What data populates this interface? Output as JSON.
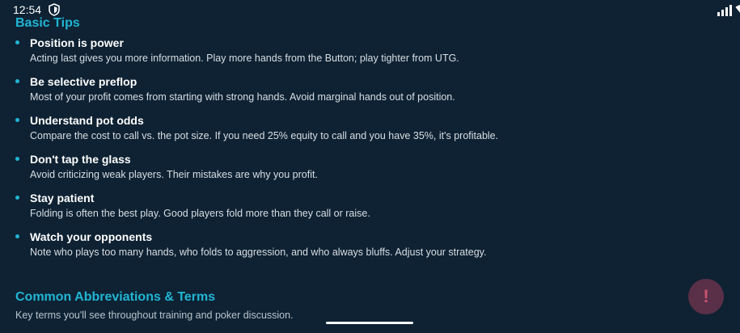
{
  "status_bar": {
    "time": "12:54",
    "icons": [
      "shield-icon",
      "signal-icon",
      "wifi-icon",
      "battery-icon"
    ]
  },
  "tips": {
    "title": "Basic Tips",
    "items": [
      {
        "title": "Position is power",
        "description": "Acting last gives you more information. Play more hands from the Button; play tighter from UTG."
      },
      {
        "title": "Be selective preflop",
        "description": "Most of your profit comes from starting with strong hands. Avoid marginal hands out of position."
      },
      {
        "title": "Understand pot odds",
        "description": "Compare the cost to call vs. the pot size. If you need 25% equity to call and you have 35%, it's profitable."
      },
      {
        "title": "Don't tap the glass",
        "description": "Avoid criticizing weak players. Their mistakes are why you profit."
      },
      {
        "title": "Stay patient",
        "description": "Folding is often the best play. Good players fold more than they call or raise."
      },
      {
        "title": "Watch your opponents",
        "description": "Note who plays too many hands, who folds to aggression, and who always bluffs. Adjust your strategy."
      }
    ]
  },
  "terms": {
    "title": "Common Abbreviations & Terms",
    "subtitle": "Key terms you'll see throughout training and poker discussion."
  },
  "fab": {
    "label": "!"
  },
  "colors": {
    "background": "#0e2233",
    "accent": "#22b5d4",
    "fab_bg": "#5a2f48",
    "fab_fg": "#c9556f"
  }
}
